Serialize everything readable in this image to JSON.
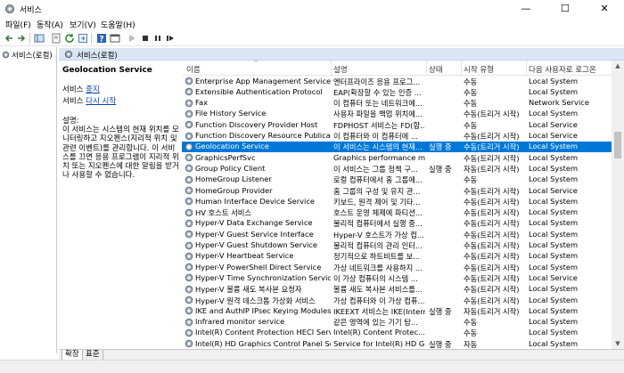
{
  "window": {
    "title": "서비스",
    "min": "—",
    "max": "☐",
    "close": "✕"
  },
  "menu": [
    {
      "label": "파일(F)"
    },
    {
      "label": "동작(A)"
    },
    {
      "label": "보기(V)"
    },
    {
      "label": "도움말(H)"
    }
  ],
  "toolbar_icons": [
    "back-arrow-icon",
    "forward-arrow-icon",
    "show-tree-icon",
    "properties-icon",
    "refresh-icon",
    "export-icon",
    "help-icon",
    "console-icon",
    "play-icon",
    "stop-icon",
    "pause-icon",
    "restart-icon"
  ],
  "tree": {
    "item": "서비스(로컬)"
  },
  "panel": {
    "header": "서비스(로컬)"
  },
  "desc": {
    "name": "Geolocation Service",
    "stop_prefix": "서비스 ",
    "stop_link": "중지",
    "restart_prefix": "서비스 ",
    "restart_link": "다시 시작",
    "label": "설명:",
    "text": "이 서비스는 시스템의 현재 위치를 모니터링하고 지오펜스(지리적 위치 및 관련 이벤트)를 관리합니다. 이 서비스를 끄면 응용 프로그램이 지리적 위치 또는 지오펜스에 대한 알림을 받거나 사용할 수 없습니다."
  },
  "columns": {
    "name": "이름",
    "desc": "설명",
    "state": "상태",
    "start": "시작 유형",
    "logon": "다음 사용자로 로그온"
  },
  "rows": [
    {
      "name": "Enterprise App Management Service",
      "desc": "엔터프라이즈 응용 프로그...",
      "state": "",
      "start": "수동",
      "logon": "Local System"
    },
    {
      "name": "Extensible Authentication Protocol",
      "desc": "EAP(확장할 수 있는 인증 ...",
      "state": "",
      "start": "수동",
      "logon": "Local System"
    },
    {
      "name": "Fax",
      "desc": "이 컴퓨터 또는 네트워크에...",
      "state": "",
      "start": "수동",
      "logon": "Network Service"
    },
    {
      "name": "File History Service",
      "desc": "사용자 파일을 백업 위치에...",
      "state": "",
      "start": "수동(트리거 시작)",
      "logon": "Local System"
    },
    {
      "name": "Function Discovery Provider Host",
      "desc": "FDPHOST 서비스는 FD(함...",
      "state": "",
      "start": "수동",
      "logon": "Local Service"
    },
    {
      "name": "Function Discovery Resource Publication",
      "desc": "이 컴퓨터와 이 컴퓨터에 ...",
      "state": "",
      "start": "수동(트리거 시작)",
      "logon": "Local Service"
    },
    {
      "name": "Geolocation Service",
      "desc": "이 서비스는 시스템의 현재...",
      "state": "실행 중",
      "start": "수동(트리거 시작)",
      "logon": "Local System",
      "selected": true
    },
    {
      "name": "GraphicsPerfSvc",
      "desc": "Graphics performance mo...",
      "state": "",
      "start": "수동(트리거 시작)",
      "logon": "Local System"
    },
    {
      "name": "Group Policy Client",
      "desc": "이 서비스는 그룹 정책 구...",
      "state": "실행 중",
      "start": "자동(트리거 시작)",
      "logon": "Local System"
    },
    {
      "name": "HomeGroup Listener",
      "desc": "로컬 컴퓨터에서 홈 그룹에...",
      "state": "",
      "start": "수동",
      "logon": "Local System"
    },
    {
      "name": "HomeGroup Provider",
      "desc": "홈 그룹의 구성 및 유지 관...",
      "state": "",
      "start": "수동(트리거 시작)",
      "logon": "Local Service"
    },
    {
      "name": "Human Interface Device Service",
      "desc": "키보드, 원격 제어 및 기타...",
      "state": "",
      "start": "수동(트리거 시작)",
      "logon": "Local System"
    },
    {
      "name": "HV 호스트 서비스",
      "desc": "호스트 운영 체제에 파티션...",
      "state": "",
      "start": "수동(트리거 시작)",
      "logon": "Local System"
    },
    {
      "name": "Hyper-V Data Exchange Service",
      "desc": "물리적 컴퓨터에서 실행 중...",
      "state": "",
      "start": "수동(트리거 시작)",
      "logon": "Local System"
    },
    {
      "name": "Hyper-V Guest Service Interface",
      "desc": "Hyper-V 호스트가 가상 컴...",
      "state": "",
      "start": "수동(트리거 시작)",
      "logon": "Local System"
    },
    {
      "name": "Hyper-V Guest Shutdown Service",
      "desc": "물리적 컴퓨터의 관리 인터...",
      "state": "",
      "start": "수동(트리거 시작)",
      "logon": "Local System"
    },
    {
      "name": "Hyper-V Heartbeat Service",
      "desc": "정기적으로 하트비트를 보...",
      "state": "",
      "start": "수동(트리거 시작)",
      "logon": "Local System"
    },
    {
      "name": "Hyper-V PowerShell Direct Service",
      "desc": "가상 네트워크를 사용하지 ...",
      "state": "",
      "start": "수동(트리거 시작)",
      "logon": "Local System"
    },
    {
      "name": "Hyper-V Time Synchronization Service",
      "desc": "이 가상 컴퓨터의 시스템 ...",
      "state": "",
      "start": "수동(트리거 시작)",
      "logon": "Local Service"
    },
    {
      "name": "Hyper-V 볼륨 새도 복사본 요청자",
      "desc": "볼륨 새도 복사본 서비스를...",
      "state": "",
      "start": "수동(트리거 시작)",
      "logon": "Local System"
    },
    {
      "name": "Hyper-V 원격 데스크톱 가상화 서비스",
      "desc": "가상 컴퓨터와 이 가상 컴퓨...",
      "state": "",
      "start": "수동(트리거 시작)",
      "logon": "Local System"
    },
    {
      "name": "IKE and AuthIP IPsec Keying Modules",
      "desc": "IKEEXT 서비스는 IKE(Intern...",
      "state": "실행 중",
      "start": "자동(트리거 시작)",
      "logon": "Local System"
    },
    {
      "name": "Infrared monitor service",
      "desc": "같은 영역에 있는 기기 탐...",
      "state": "",
      "start": "수동",
      "logon": "Local System"
    },
    {
      "name": "Intel(R) Content Protection HECI Service",
      "desc": "Intel(R) Content Protec...",
      "state": "",
      "start": "수동",
      "logon": "Local System"
    },
    {
      "name": "Intel(R) HD Graphics Control Panel Service",
      "desc": "Service for Intel(R) HD Gra...",
      "state": "실행 중",
      "start": "자동",
      "logon": "Local System"
    }
  ],
  "tabs": [
    {
      "label": "확장"
    },
    {
      "label": "표준"
    }
  ]
}
